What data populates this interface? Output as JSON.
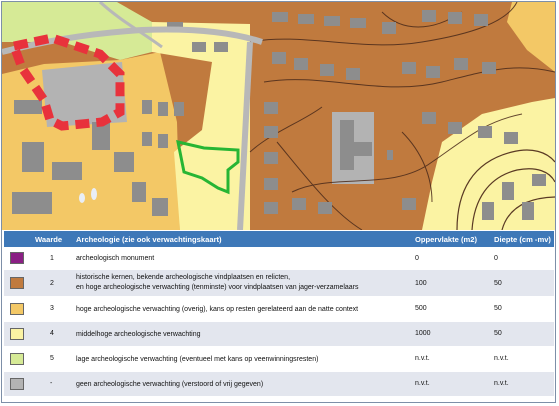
{
  "map": {
    "colors": {
      "hoge": "#c07a3e",
      "overig": "#f3c866",
      "middelhoog": "#fbf3a3",
      "laag": "#d6ea96",
      "geen": "#b3b3b3",
      "monument": "#8a1f84",
      "buildings": "#8d8d8d",
      "boundary_green": "#27b534",
      "boundary_red": "#e8323c",
      "road": "#b8b8b8",
      "contour": "#4a2a1a"
    }
  },
  "legend": {
    "headers": {
      "value": "Waarde",
      "archaeology": "Archeologie (zie ook verwachtingskaart)",
      "area": "Oppervlakte (m2)",
      "depth": "Diepte (cm -mv)"
    },
    "rows": [
      {
        "color": "#8a1f84",
        "value": "1",
        "desc": "archeologisch monument",
        "desc2": "",
        "area": "0",
        "depth": "0"
      },
      {
        "color": "#c07a3e",
        "value": "2",
        "desc": "historische kernen, bekende archeologische vindplaatsen en relicten,",
        "desc2": "en hoge archeologische verwachting (tenminste) voor vindplaatsen van jager-verzamelaars",
        "area": "100",
        "depth": "50"
      },
      {
        "color": "#f3c866",
        "value": "3",
        "desc": "hoge archeologische verwachting (overig), kans op resten gerelateerd aan de natte context",
        "desc2": "",
        "area": "500",
        "depth": "50"
      },
      {
        "color": "#fbf3a3",
        "value": "4",
        "desc": "middelhoge archeologische verwachting",
        "desc2": "",
        "area": "1000",
        "depth": "50"
      },
      {
        "color": "#d6ea96",
        "value": "5",
        "desc": "lage archeologische verwachting (eventueel met kans op veenwinningsresten)",
        "desc2": "",
        "area": "n.v.t.",
        "depth": "n.v.t."
      },
      {
        "color": "#b3b3b3",
        "value": "-",
        "desc": "geen archeologische verwachting (verstoord of vrij gegeven)",
        "desc2": "",
        "area": "n.v.t.",
        "depth": "n.v.t."
      }
    ]
  }
}
